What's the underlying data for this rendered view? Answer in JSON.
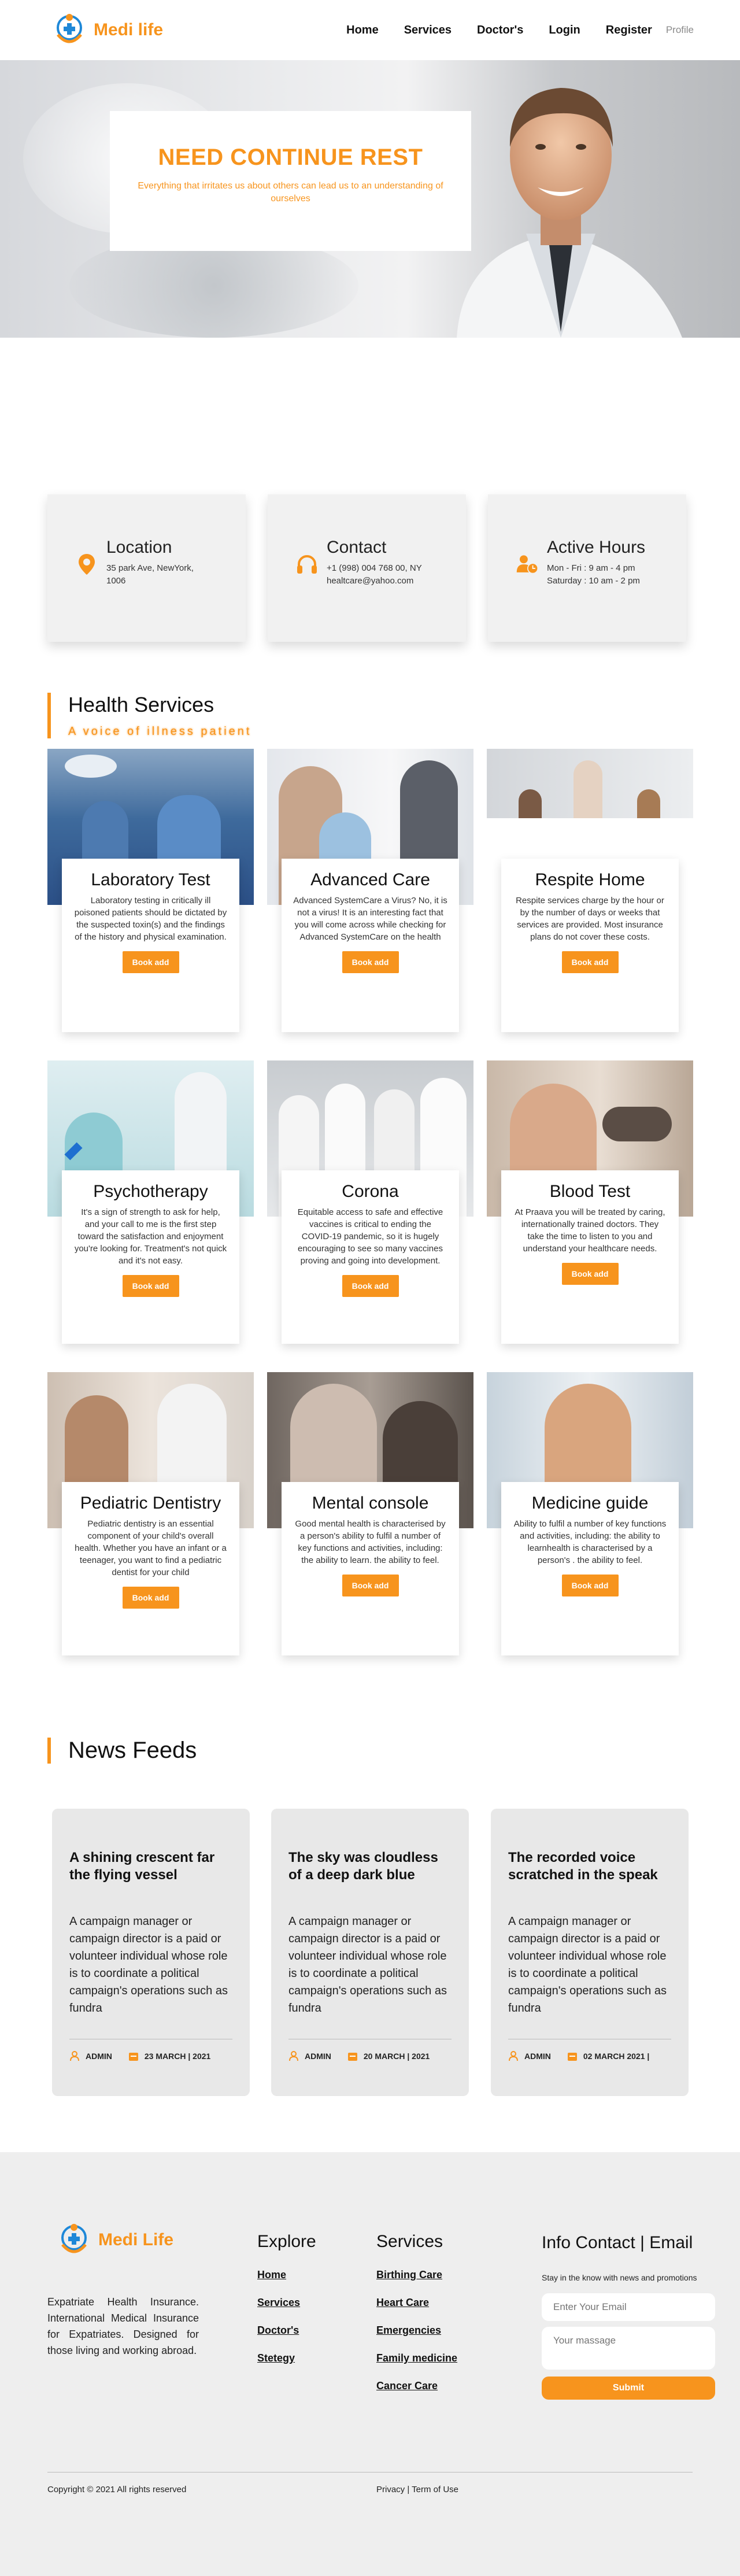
{
  "brand": {
    "name_part1": "Medi",
    "name_part2": " life",
    "footer_name": "Medi Life"
  },
  "nav": {
    "items": [
      "Home",
      "Services",
      "Doctor's",
      "Login",
      "Register"
    ],
    "profile": "Profile"
  },
  "hero": {
    "title": "NEED CONTINUE REST",
    "subtitle": "Everything that irritates us about others can lead us to an understanding of ourselves"
  },
  "info": [
    {
      "title": "Location",
      "line1": "35 park Ave, NewYork,",
      "line2": "1006",
      "icon": "map-pin-icon"
    },
    {
      "title": "Contact",
      "line1": "+1 (998) 004 768 00, NY",
      "line2": "healtcare@yahoo.com",
      "icon": "headphones-icon"
    },
    {
      "title": "Active Hours",
      "line1": "Mon - Fri : 9 am - 4 pm",
      "line2": "Saturday : 10 am - 2 pm",
      "icon": "user-clock-icon"
    }
  ],
  "health": {
    "title": "Health Services",
    "subtitle": "A voice of illness patient"
  },
  "services": [
    {
      "title": "Laboratory Test",
      "text": "Laboratory testing in critically ill poisoned patients should be dictated by the suspected toxin(s) and the findings of the history and physical examination.",
      "button": "Book add"
    },
    {
      "title": "Advanced Care",
      "text": "Advanced SystemCare a Virus? No, it is not a virus! It is an interesting fact that you will come across while checking for Advanced SystemCare on the health",
      "button": "Book add"
    },
    {
      "title": "Respite Home",
      "text": "Respite services charge by the hour or by the number of days or weeks that services are provided. Most insurance plans do not cover these costs.",
      "button": "Book add"
    },
    {
      "title": "Psychotherapy",
      "text": "It's a sign of strength to ask for help, and your call to me is the first step toward the satisfaction and enjoyment you're looking for. Treatment's not quick and it's not easy.",
      "button": "Book add"
    },
    {
      "title": "Corona",
      "text": "Equitable access to safe and effective vaccines is critical to ending the COVID-19 pandemic, so it is hugely encouraging to see so many vaccines proving and going into development.",
      "button": "Book add"
    },
    {
      "title": "Blood Test",
      "text": "At Praava you will be treated by caring, internationally trained doctors. They take the time to listen to you and understand your healthcare needs.",
      "button": "Book add"
    },
    {
      "title": "Pediatric Dentistry",
      "text": "Pediatric dentistry is an essential component of your child's overall health. Whether you have an infant or a teenager, you want to find a pediatric dentist for your child",
      "button": "Book add"
    },
    {
      "title": "Mental console",
      "text": "Good mental health is characterised by a person's ability to fulfil a number of key functions and activities, including: the ability to learn. the ability to feel.",
      "button": "Book add"
    },
    {
      "title": "Medicine guide",
      "text": "Ability to fulfil a number of key functions and activities, including: the ability to learnhealth is characterised by a person's . the ability to feel.",
      "button": "Book add"
    }
  ],
  "news": {
    "title": "News Feeds",
    "items": [
      {
        "title": "A shining crescent far the flying vessel",
        "text": "A campaign manager or campaign director is a paid or volunteer individual whose role is to coordinate a political campaign's operations such as fundra",
        "author": "ADMIN",
        "date": "23 MARCH | 2021"
      },
      {
        "title": "The sky was cloudless of a deep dark blue",
        "text": "A campaign manager or campaign director is a paid or volunteer individual whose role is to coordinate a political campaign's operations such as fundra",
        "author": "ADMIN",
        "date": "20 MARCH | 2021"
      },
      {
        "title": "The recorded voice scratched in the speak",
        "text": "A campaign manager or campaign director is a paid or volunteer individual whose role is to coordinate a political campaign's operations such as fundra",
        "author": "ADMIN",
        "date": "02 MARCH 2021 |"
      }
    ]
  },
  "footer": {
    "about": "Expatriate Health Insurance. International Medical Insurance for Expatriates. Designed for those living and working abroad.",
    "explore": {
      "title": "Explore",
      "links": [
        "Home",
        "Services",
        "Doctor's",
        "Stetegy"
      ]
    },
    "services": {
      "title": "Services",
      "links": [
        "Birthing Care",
        "Heart Care",
        "Emergencies",
        "Family medicine",
        "Cancer Care"
      ]
    },
    "contact": {
      "title": "Info Contact | Email",
      "note": "Stay in the know with news and promotions",
      "email_placeholder": "Enter Your Email",
      "message_placeholder": "Your massage",
      "submit": "Submit"
    },
    "copyright": "Copyright © 2021 All rights reserved",
    "legal": "Privacy | Term of Use"
  },
  "colors": {
    "accent": "#f7941d",
    "card_bg": "#f1f1f1",
    "footer_bg": "#eeeeee"
  }
}
